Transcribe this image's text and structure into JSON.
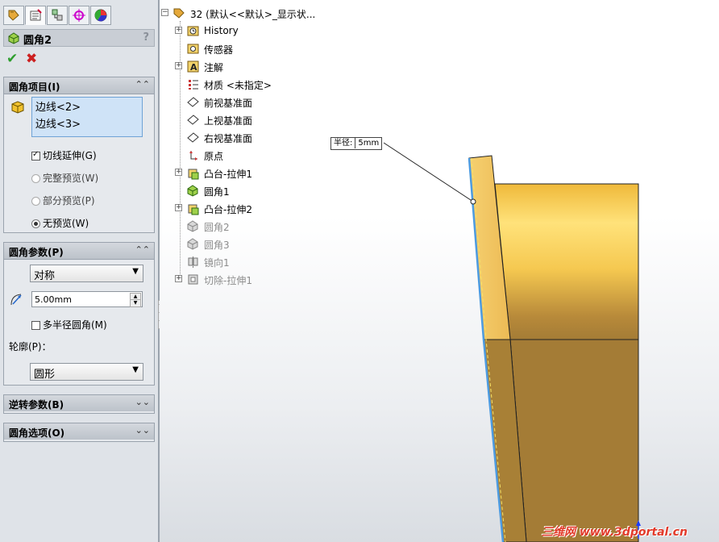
{
  "property_manager": {
    "title": "圆角2",
    "help": "?",
    "tabs": [
      "feature-manager-tab",
      "property-manager-tab",
      "configuration-manager-tab",
      "dimxpert-tab",
      "display-manager-tab"
    ],
    "fillet_items": {
      "header": "圆角项目(I)",
      "edges": [
        "边线<2>",
        "边线<3>"
      ],
      "tangent_propagation": {
        "label": "切线延伸(G)",
        "checked": true
      },
      "preview_options": [
        {
          "label": "完整预览(W)",
          "selected": false
        },
        {
          "label": "部分预览(P)",
          "selected": false
        },
        {
          "label": "无预览(W)",
          "selected": true
        }
      ]
    },
    "fillet_params": {
      "header": "圆角参数(P)",
      "method": "对称",
      "radius": "5.00mm",
      "multi_radius": {
        "label": "多半径圆角(M)",
        "checked": false
      },
      "profile_label": "轮廓(P)：",
      "profile": "圆形"
    },
    "reverse_params": {
      "header": "逆转参数(B)"
    },
    "fillet_options": {
      "header": "圆角选项(O)"
    }
  },
  "feature_tree": {
    "root": "32  (默认<<默认>_显示状...",
    "items": [
      {
        "label": "History",
        "icon": "history-icon",
        "expandable": true,
        "suppressed": false
      },
      {
        "label": "传感器",
        "icon": "sensor-icon",
        "expandable": false,
        "suppressed": false
      },
      {
        "label": "注解",
        "icon": "annotation-icon",
        "expandable": true,
        "suppressed": false
      },
      {
        "label": "材质 <未指定>",
        "icon": "material-icon",
        "expandable": false,
        "suppressed": false
      },
      {
        "label": "前视基准面",
        "icon": "plane-icon",
        "expandable": false,
        "suppressed": false
      },
      {
        "label": "上视基准面",
        "icon": "plane-icon",
        "expandable": false,
        "suppressed": false
      },
      {
        "label": "右视基准面",
        "icon": "plane-icon",
        "expandable": false,
        "suppressed": false
      },
      {
        "label": "原点",
        "icon": "origin-icon",
        "expandable": false,
        "suppressed": false
      },
      {
        "label": "凸台-拉伸1",
        "icon": "extrude-boss-icon",
        "expandable": true,
        "suppressed": false
      },
      {
        "label": "圆角1",
        "icon": "fillet-icon",
        "expandable": false,
        "suppressed": false
      },
      {
        "label": "凸台-拉伸2",
        "icon": "extrude-boss-icon",
        "expandable": true,
        "suppressed": false
      },
      {
        "label": "圆角2",
        "icon": "fillet-icon",
        "expandable": false,
        "suppressed": true
      },
      {
        "label": "圆角3",
        "icon": "fillet-icon",
        "expandable": false,
        "suppressed": true
      },
      {
        "label": "镜向1",
        "icon": "mirror-icon",
        "expandable": false,
        "suppressed": true
      },
      {
        "label": "切除-拉伸1",
        "icon": "extrude-cut-icon",
        "expandable": true,
        "suppressed": true
      }
    ]
  },
  "graphics": {
    "radius_callout": {
      "label": "半径:",
      "value": "5mm"
    },
    "model_colors": {
      "top": "#f0be3a",
      "bottom": "#a47c36",
      "edge_highlight": "#4d9be0"
    },
    "watermark": "三维网 www.3dportal.cn"
  }
}
